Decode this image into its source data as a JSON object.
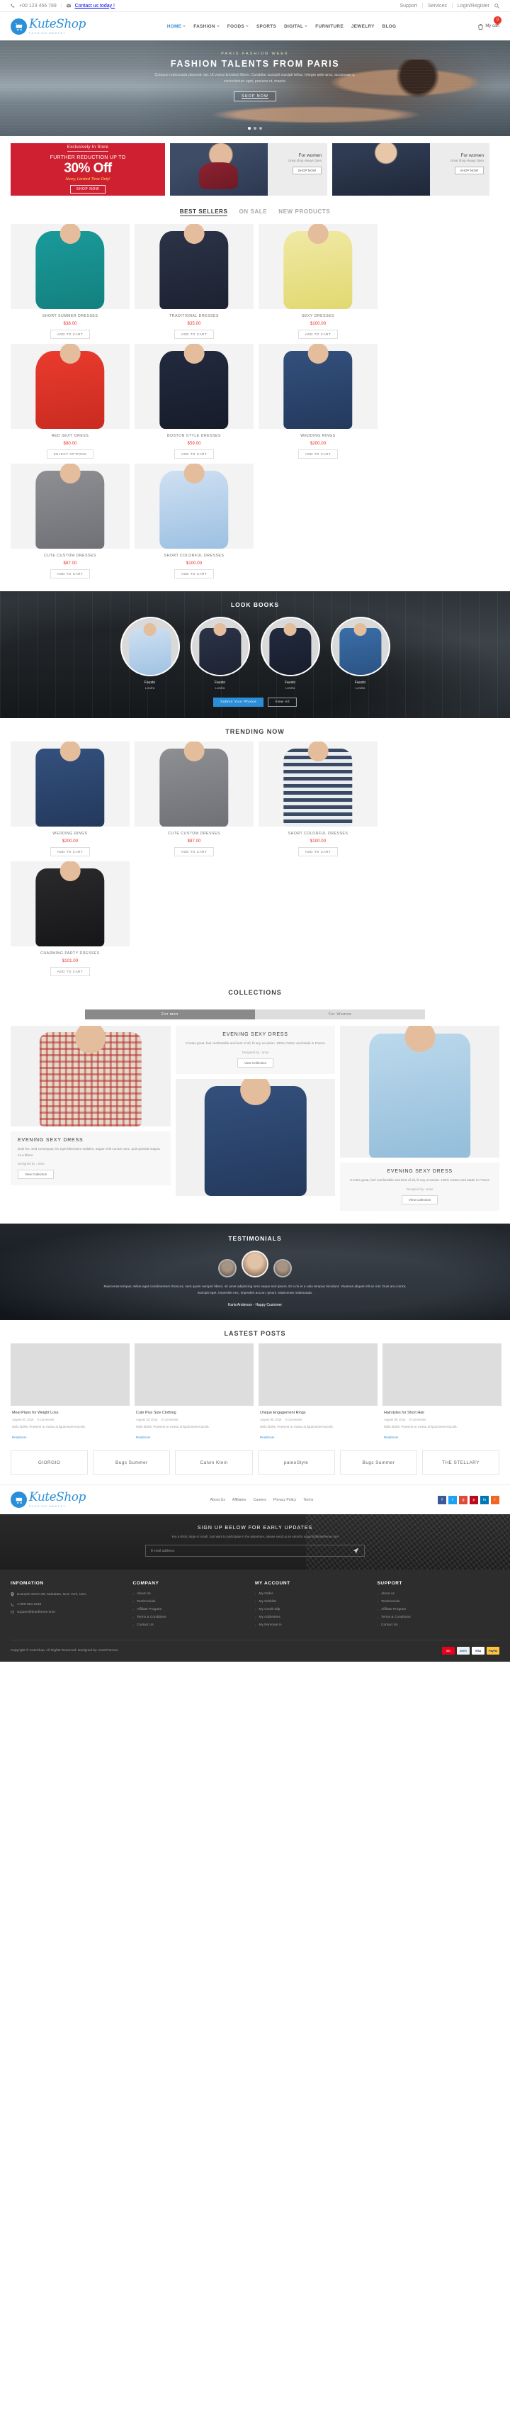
{
  "topbar": {
    "phone": "+00 123 456 789",
    "contact": "Contact us today !",
    "support": "Support",
    "services": "Services",
    "login": "Login/Register",
    "search_icon": "search-icon",
    "phone_icon": "phone-icon",
    "mail_icon": "mail-icon"
  },
  "header": {
    "logo_name": "KuteShop",
    "logo_sub": "FASHION MARKET",
    "nav": [
      {
        "label": "HOME",
        "caret": true,
        "active": true
      },
      {
        "label": "FASHION",
        "caret": true,
        "active": false
      },
      {
        "label": "FOODS",
        "caret": true,
        "active": false
      },
      {
        "label": "SPORTS",
        "caret": false,
        "active": false
      },
      {
        "label": "DIGITAL",
        "caret": true,
        "active": false
      },
      {
        "label": "FURNITURE",
        "caret": false,
        "active": false
      },
      {
        "label": "JEWELRY",
        "caret": false,
        "active": false
      },
      {
        "label": "BLOG",
        "caret": false,
        "active": false
      }
    ],
    "cart_label": "My cart",
    "cart_count": "0"
  },
  "hero": {
    "kicker": "PARIS FASHION WEEK",
    "title": "FASHION TALENTS FROM PARIS",
    "desc": "Quisque malesuada placerat nisi. Ut varius tincidunt libero. Curabitur suscipit suscipit tellus. Integer ante arcu, accumsan a, consectetuer eget, posuere ut, mauris.",
    "button": "SHOP NOW"
  },
  "promo": {
    "red": {
      "line1": "Exclusively In Store",
      "line2": "FURTHER REDUCTION UP TO",
      "line3": "30% Off",
      "line4": "Hurry, Limited Time Only!",
      "button": "SHOP NOW"
    },
    "cards": [
      {
        "title": "For women",
        "sub": "Great Shop Always Open",
        "button": "SHOP NOW",
        "style": "men"
      },
      {
        "title": "For women",
        "sub": "Great Shop Always Open",
        "button": "SHOP NOW",
        "style": "women"
      }
    ]
  },
  "bestsellers": {
    "tabs": [
      "BEST SELLERS",
      "ON SALE",
      "NEW PRODUCTS"
    ],
    "active_tab": "BEST SELLERS",
    "products": [
      {
        "name": "SHORT SUMMER DRESSES",
        "price": "$38.00",
        "cta": "ADD TO CART",
        "fig": "f-teal"
      },
      {
        "name": "TRADITIONAL DRESSES",
        "price": "$35.00",
        "cta": "ADD TO CART",
        "fig": "f-navydot"
      },
      {
        "name": "SEXY DRESSES",
        "price": "$100.00",
        "cta": "ADD TO CART",
        "fig": "f-yellow"
      },
      {
        "name": "RED SEXY DRESS",
        "price": "$80.00",
        "cta": "SELECT OPTIONS",
        "fig": "f-red"
      },
      {
        "name": "BOSTON STYLE DRESSES",
        "price": "$59.00",
        "cta": "ADD TO CART",
        "fig": "f-darknv"
      },
      {
        "name": "WEDDING RINGS",
        "price": "$200.00",
        "cta": "ADD TO CART",
        "fig": "f-denim"
      },
      {
        "name": "CUTE CUSTOM DRESSES",
        "price": "$87.00",
        "cta": "ADD TO CART",
        "fig": "f-gray"
      },
      {
        "name": "SHORT COLORFUL DRESSES",
        "price": "$100.00",
        "cta": "ADD TO CART",
        "fig": "f-floral"
      }
    ]
  },
  "lookbook": {
    "title": "LOOK BOOKS",
    "items": [
      {
        "name": "Fausto",
        "location": "Londra",
        "fig": "f-floral"
      },
      {
        "name": "Fausto",
        "location": "Londra",
        "fig": "f-navydot"
      },
      {
        "name": "Fausto",
        "location": "Londra",
        "fig": "f-darknv"
      },
      {
        "name": "Fausto",
        "location": "Londra",
        "fig": "f-blue"
      }
    ],
    "submit_button": "Submit Your Photos",
    "viewall_button": "View All"
  },
  "trending": {
    "title": "TRENDING NOW",
    "products": [
      {
        "name": "WEDDING RINGS",
        "price": "$200.00",
        "cta": "ADD TO CART",
        "fig": "f-denim"
      },
      {
        "name": "CUTE CUSTOM DRESSES",
        "price": "$87.00",
        "cta": "ADD TO CART",
        "fig": "f-gray"
      },
      {
        "name": "SHORT COLORFUL DRESSES",
        "price": "$100.00",
        "cta": "ADD TO CART",
        "fig": "f-stripe"
      },
      {
        "name": "CHARMING PARTY DRESSES",
        "price": "$101.00",
        "cta": "ADD TO CART",
        "fig": "f-black"
      }
    ]
  },
  "collections": {
    "title": "COLLECTIONS",
    "toggle_on": "For men",
    "toggle_off": "For Women",
    "left": {
      "heading": "EVENING SEXY DRESS",
      "desc": "Duis leo. Sed consequat, leo eget bibendum sodales, augue velit cursus nunc, quis gravida magna mi a libero.",
      "by": "Designed by : anne",
      "button": "View Collection",
      "fig": "f-plaid"
    },
    "mid": {
      "heading": "EVENING SEXY DRESS",
      "desc": "It looks great, feel comfortable and best of all, fit any occasion. 100% Cotton and Made in France",
      "by": "Designed by : anne",
      "button": "View Collection",
      "fig": "f-denim"
    },
    "right": {
      "heading": "EVENING SEXY DRESS",
      "desc": "It looks great, feel comfortable and best of all, fit any occasion. 100% Cotton and Made in France",
      "by": "Designed by : anne",
      "button": "View Collection",
      "fig": "f-ltblue"
    }
  },
  "testimonials": {
    "title": "TESTIMONIALS",
    "quote": "Maecenas tempus, tellus eget condimentum rhoncus, sem quam semper libero, sit amet adipiscing sem neque sed ipsum. Et a mi et a odio tempus tincidunt. Vivamus aliquet elit ac nisl. Duis arcu tortor, suscipit eget, imperdiet nec, imperdiet accum, ipsum. Maecenas malesuada.",
    "author": "Karla Anderson - Happy Customer"
  },
  "posts": {
    "title": "LASTEST POSTS",
    "items": [
      {
        "title": "Meal Plans for Weight Loss",
        "date": "August 04, 2015",
        "comments": "0 Comments",
        "desc": "Nulla facilisi. Praesent ac massa at ligula laoreet iaculis.",
        "read": "Readmore",
        "style": "ps1"
      },
      {
        "title": "Cute Plus Size Clothing",
        "date": "August 18, 2015",
        "comments": "0 Comments",
        "desc": "Nulla facilisi. Praesent ac massa at ligula laoreet iaculis.",
        "read": "Readmore",
        "style": "ps2"
      },
      {
        "title": "Unique Engagement Rings",
        "date": "August 08, 2015",
        "comments": "0 Comments",
        "desc": "Nulla facilisi. Praesent ac massa at ligula laoreet iaculis.",
        "read": "Readmore",
        "style": "ps3"
      },
      {
        "title": "Hairstyles for Short Hair",
        "date": "August 06, 2015",
        "comments": "0 Comments",
        "desc": "Nulla facilisi. Praesent ac massa at ligula laoreet iaculis.",
        "read": "Readmore",
        "style": "ps4"
      }
    ]
  },
  "brands": [
    "GIORGIO",
    "Bugs Summer",
    "Calvin Klein",
    "paleoStyle",
    "Bugs Summer",
    "THE STELLARY"
  ],
  "footer_top": {
    "links": [
      "About Us",
      "Affiliates",
      "Careers",
      "Privacy Policy",
      "Terms"
    ],
    "socials": [
      "facebook-icon",
      "twitter-icon",
      "google-plus-icon",
      "pinterest-icon",
      "linkedin-icon",
      "rss-icon"
    ]
  },
  "newsletter": {
    "heading": "SIGN UP BELOW FOR EARLY UPDATES",
    "sub": "You a short, large or small. Just want to participate in the adventure, please send us an email to support@kutetheme.com",
    "placeholder": "E-mail address",
    "send_icon": "send-icon"
  },
  "footer": {
    "columns": [
      {
        "title": "INFOMATION",
        "type": "address",
        "address": "Example Street 68, Mahattan, New York, USA.",
        "phone": "1-899-353-2268",
        "email": "support@kutetheme.nnet"
      },
      {
        "title": "COMPANY",
        "type": "links",
        "items": [
          "About Us",
          "Testimonials",
          "Affiliate Program",
          "Terms & Conditions",
          "Contact Us"
        ]
      },
      {
        "title": "MY ACCOUNT",
        "type": "links",
        "items": [
          "My Order",
          "My Wishlist",
          "My Credit Slip",
          "My Addresses",
          "My Personal In"
        ]
      },
      {
        "title": "SUPPORT",
        "type": "links",
        "items": [
          "About us",
          "Testimonials",
          "Affiliate Program",
          "Terms & Conditions",
          "Contact Us"
        ]
      }
    ],
    "copyright": "Copyright © KuteShop. All Rights Reserved. Designed by: KuteThemes",
    "payments": [
      "MC",
      "AMEX",
      "VISA",
      "PayPal"
    ]
  },
  "colors": {
    "brand": "#2a8fd8",
    "price": "#e8342c",
    "promo_red": "#cf2032",
    "footer_dark": "#2d2d2d"
  }
}
